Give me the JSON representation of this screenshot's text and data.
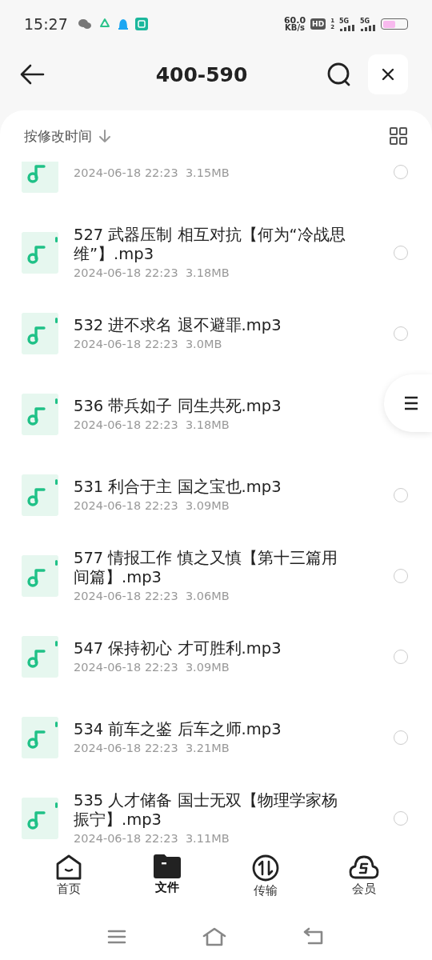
{
  "status_bar": {
    "time": "15:27",
    "speed": "60.0",
    "speed_unit": "KB/s",
    "hd": "HD",
    "sim_digits": [
      "1",
      "2"
    ],
    "networks": [
      "5G",
      "5G"
    ],
    "battery": {
      "level": 0.55
    }
  },
  "header": {
    "title": "400-590"
  },
  "sort": {
    "label": "按修改时间"
  },
  "files": [
    {
      "meta": "2024-06-18 22:23  3.15MB",
      "selected": false
    },
    {
      "name": "527 武器压制 相互对抗【何为“冷战思维”】.mp3",
      "meta": "2024-06-18 22:23  3.18MB",
      "selected": false
    },
    {
      "name": "532 进不求名 退不避罪.mp3",
      "meta": "2024-06-18 22:23  3.0MB",
      "selected": false
    },
    {
      "name": "536 带兵如子 同生共死.mp3",
      "meta": "2024-06-18 22:23  3.18MB"
    },
    {
      "name": "531 利合于主 国之宝也.mp3",
      "meta": "2024-06-18 22:23  3.09MB",
      "selected": false
    },
    {
      "name": "577 情报工作 慎之又慎【第十三篇用间篇】.mp3",
      "meta": "2024-06-18 22:23  3.06MB",
      "selected": false
    },
    {
      "name": "547 保持初心 才可胜利.mp3",
      "meta": "2024-06-18 22:23  3.09MB",
      "selected": false
    },
    {
      "name": "534 前车之鉴 后车之师.mp3",
      "meta": "2024-06-18 22:23  3.21MB",
      "selected": false
    },
    {
      "name": "535 人才储备 国士无双【物理学家杨振宁】.mp3",
      "meta": "2024-06-18 22:23  3.11MB",
      "selected": false
    }
  ],
  "bottom_nav": [
    {
      "label": "首页",
      "kind": "home",
      "selected": false
    },
    {
      "label": "文件",
      "kind": "files",
      "selected": true
    },
    {
      "label": "传输",
      "kind": "transfer",
      "selected": false
    },
    {
      "label": "会员",
      "kind": "vip",
      "selected": false
    }
  ]
}
